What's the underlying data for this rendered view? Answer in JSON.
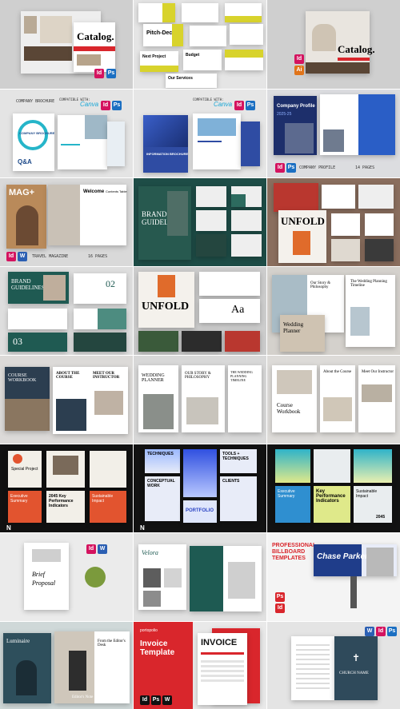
{
  "tiles": {
    "catalog1": {
      "title": "Catalog."
    },
    "pitch": {
      "title": "Pitch-Deck",
      "project": "Next Project",
      "budget": "Budget",
      "services": "Our Services"
    },
    "catalog2": {
      "title": "Catalog."
    },
    "brochure": {
      "header_left": "COMPANY BROCHURE",
      "compat": "COMPATIBLE WITH:",
      "app": "Canva",
      "cover": "COMPANY BROCHURE",
      "qa": "Q&A"
    },
    "info_brochure": {
      "compat": "COMPATIBLE WITH:",
      "app": "Canva",
      "cover": "INFORMATION BROCHURE"
    },
    "company_profile": {
      "title": "Company Profile",
      "years": "2025-25",
      "footer": "COMPANY PROFILE",
      "pages": "14 PAGES"
    },
    "magazine": {
      "title": "MAG+",
      "welcome": "Welcome",
      "toc": "Contents Table",
      "footer": "TRAVEL MAGAZINE",
      "pages": "16 PAGES"
    },
    "brand1": {
      "title": "BRAND GUIDELINES"
    },
    "unfold1": {
      "title": "UNFOLD"
    },
    "brand2": {
      "title": "BRAND GUIDELINES",
      "n1": "02",
      "n2": "03"
    },
    "unfold2": {
      "title": "UNFOLD",
      "aa": "Aa"
    },
    "wedding1": {
      "story": "Our Story & Philosophy",
      "timeline": "The Wedding Planning Timeline",
      "cover": "Wedding Planner"
    },
    "course1": {
      "cover": "COURSE WORKBOOK",
      "about": "ABOUT THE COURSE",
      "instructor": "MEET OUR INSTRUCTOR"
    },
    "wedding2": {
      "cover": "WEDDING PLANNER",
      "story": "OUR STORY & PHILOSOPHY",
      "timeline": "THE WEDDING PLANNING TIMELINE"
    },
    "course2": {
      "cover": "Course Workbook",
      "about": "About the Course",
      "instructor": "Meet Our Instructor"
    },
    "kpi1": {
      "special": "Special Project",
      "exec": "Executive Summary",
      "kpi": "2045 Key Performance Indicators",
      "impact": "Sustainable Impact",
      "logo": "N"
    },
    "portfolio": {
      "techniques": "TECHNIQUES",
      "tools": "TOOLS + TECHNIQUES",
      "conceptual": "CONCEPTUAL WORK",
      "clients": "CLIENTS",
      "portfolio": "PORTFOLIO",
      "logo": "N"
    },
    "kpi2": {
      "exec": "Executive Summary",
      "kpi": "Key Performance Indicators",
      "impact": "Sustainable Impact",
      "year": "2045"
    },
    "brief": {
      "title": "Brief Proposal"
    },
    "velora": {
      "title": "Velora"
    },
    "billboard": {
      "heading": "PROFESSIONAL BILLBOARD TEMPLATES",
      "name": "Chase Parker"
    },
    "luminaire": {
      "title": "Luminaire",
      "editor": "From the Editor's Desk",
      "note": "Editor's Note"
    },
    "invoice1": {
      "brand": "portopolio",
      "title": "Invoice Template",
      "invoice": "INVOICE"
    },
    "church": {
      "title": "CHURCH NAME"
    }
  },
  "colors": {
    "accent_red": "#d9262c",
    "teal": "#1e5a52",
    "yellow": "#d8d32c",
    "navy": "#1f3d8a",
    "black": "#111111"
  }
}
